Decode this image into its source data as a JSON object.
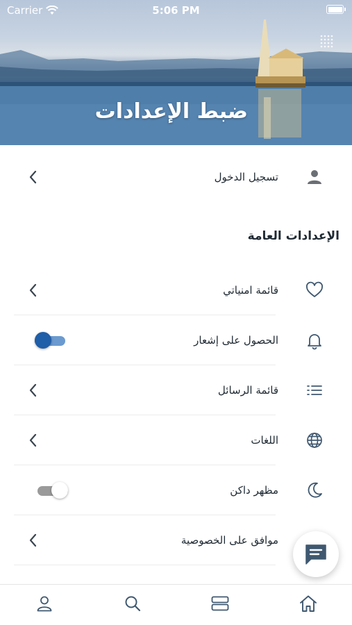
{
  "status_bar": {
    "carrier": "Carrier",
    "time": "5:06 PM"
  },
  "header": {
    "title": "ضبط الإعدادات"
  },
  "login_row": {
    "label": "تسجيل الدخول",
    "icon": "user-icon"
  },
  "general": {
    "title": "الإعدادات العامة",
    "items": [
      {
        "label": "قائمة امنياتي",
        "icon": "heart-icon",
        "control": "chevron"
      },
      {
        "label": "الحصول على إشعار",
        "icon": "bell-icon",
        "control": "toggle",
        "enabled": true
      },
      {
        "label": "قائمة الرسائل",
        "icon": "list-icon",
        "control": "chevron"
      },
      {
        "label": "اللغات",
        "icon": "globe-icon",
        "control": "chevron"
      },
      {
        "label": "مظهر داكن",
        "icon": "moon-icon",
        "control": "toggle",
        "enabled": false
      },
      {
        "label": "موافق على الخصوصية",
        "icon": "shield-icon",
        "control": "chevron"
      }
    ]
  },
  "fab": {
    "icon": "chat-icon"
  },
  "tabbar": {
    "tabs": [
      "profile-icon",
      "search-icon",
      "categories-icon",
      "home-icon"
    ]
  },
  "colors": {
    "accent": "#1f5ea8",
    "icon": "#3f5870",
    "toggle_on_track": "#6b9ad0"
  }
}
